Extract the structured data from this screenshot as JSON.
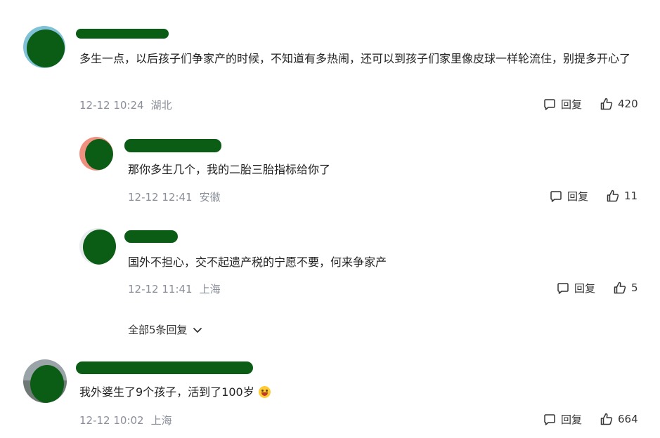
{
  "comments": [
    {
      "text": "多生一点，以后孩子们争家产的时候，不知道有多热闹，还可以到孩子们家里像皮球一样轮流住，别提多开心了",
      "time": "12-12 10:24",
      "location": "湖北",
      "reply_label": "回复",
      "likes": "420",
      "replies": [
        {
          "text": "那你多生几个，我的二胎三胎指标给你了",
          "time": "12-12 12:41",
          "location": "安徽",
          "reply_label": "回复",
          "likes": "11"
        },
        {
          "text": "国外不担心，交不起遗产税的宁愿不要，何来争家产",
          "time": "12-12 11:41",
          "location": "上海",
          "reply_label": "回复",
          "likes": "5"
        }
      ],
      "expand_label": "全部5条回复"
    },
    {
      "text": "我外婆生了9个孩子，活到了100岁",
      "emoji": "grinning-sweat-emoji",
      "time": "12-12 10:02",
      "location": "上海",
      "reply_label": "回复",
      "likes": "664"
    }
  ],
  "colors": {
    "redaction": "#0b5d16",
    "meta": "#8a8f99"
  }
}
